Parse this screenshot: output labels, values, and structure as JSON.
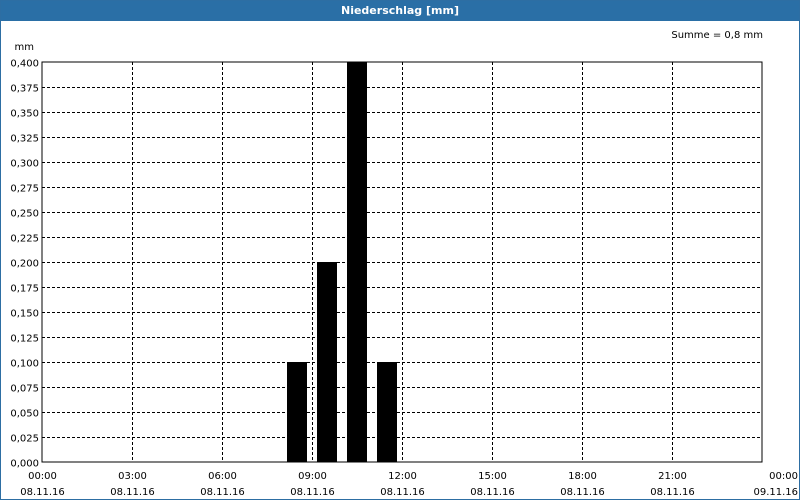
{
  "window": {
    "title": "Niederschlag [mm]"
  },
  "chart_data": {
    "type": "bar",
    "ylabel": "mm",
    "annotation": "Summe = 0,8 mm",
    "ylim": [
      0,
      0.4
    ],
    "y_ticks": [
      "0,000",
      "0,025",
      "0,050",
      "0,075",
      "0,100",
      "0,125",
      "0,150",
      "0,175",
      "0,200",
      "0,225",
      "0,250",
      "0,275",
      "0,300",
      "0,325",
      "0,350",
      "0,375",
      "0,400"
    ],
    "xlim_hours": [
      0,
      24
    ],
    "x_ticks": [
      {
        "time": "00:00",
        "date": "08.11.16"
      },
      {
        "time": "03:00",
        "date": "08.11.16"
      },
      {
        "time": "06:00",
        "date": "08.11.16"
      },
      {
        "time": "09:00",
        "date": "08.11.16"
      },
      {
        "time": "12:00",
        "date": "08.11.16"
      },
      {
        "time": "15:00",
        "date": "08.11.16"
      },
      {
        "time": "18:00",
        "date": "08.11.16"
      },
      {
        "time": "21:00",
        "date": "08.11.16"
      },
      {
        "time": "00:00",
        "date": "09.11.16"
      }
    ],
    "series": [
      {
        "bars": [
          {
            "time": "08:30",
            "value": 0.1
          },
          {
            "time": "09:30",
            "value": 0.2
          },
          {
            "time": "10:30",
            "value": 0.4
          },
          {
            "time": "11:30",
            "value": 0.1
          }
        ]
      }
    ],
    "grid": true,
    "colors": {
      "bar": "#000000",
      "grid": "#000000",
      "title_bar": "#2a6fa6"
    }
  }
}
